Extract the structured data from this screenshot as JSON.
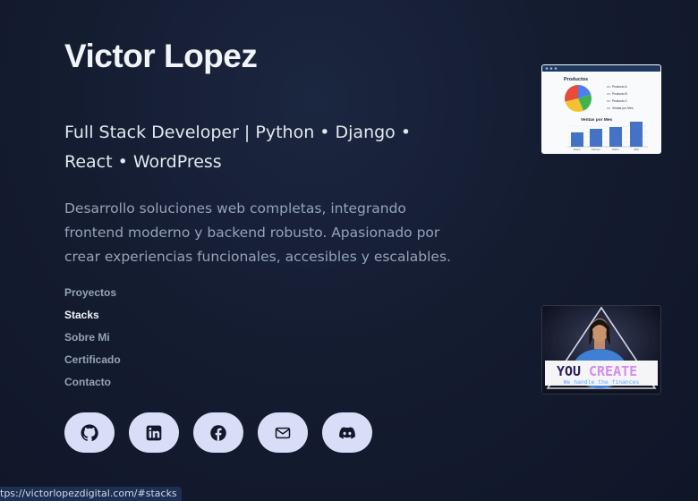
{
  "hero": {
    "name": "Victor Lopez",
    "tagline": "Full Stack Developer | Python • Django • React • WordPress",
    "description": "Desarrollo soluciones web completas, integrando frontend moderno y backend robusto. Apasionado por crear experiencias funcionales, accesibles y escalables."
  },
  "nav": {
    "items": [
      {
        "label": "Proyectos",
        "active": false
      },
      {
        "label": "Stacks",
        "active": true
      },
      {
        "label": "Sobre Mi",
        "active": false
      },
      {
        "label": "Certificado",
        "active": false
      },
      {
        "label": "Contacto",
        "active": false
      }
    ]
  },
  "socials": [
    {
      "icon": "github-icon"
    },
    {
      "icon": "linkedin-icon"
    },
    {
      "icon": "facebook-icon"
    },
    {
      "icon": "mail-icon"
    },
    {
      "icon": "discord-icon"
    }
  ],
  "projects": {
    "thumb1": {
      "title": "Productos",
      "legend": [
        "Producto A",
        "Producto B",
        "Producto C",
        "Ventas por Mes"
      ],
      "bar_title": "Ventas por Mes",
      "months": [
        "Enero",
        "Febrero",
        "Marzo",
        "Abril"
      ]
    },
    "thumb2": {
      "brand_a": "YOU",
      "brand_b": "CREATE",
      "slogan": "We handle the finances"
    }
  },
  "status_bar": {
    "url": "tps://victorlopezdigital.com/#stacks"
  },
  "colors": {
    "background": "#131b2e",
    "button_bg": "#d8def7",
    "accent_text": "#94a3b8"
  }
}
